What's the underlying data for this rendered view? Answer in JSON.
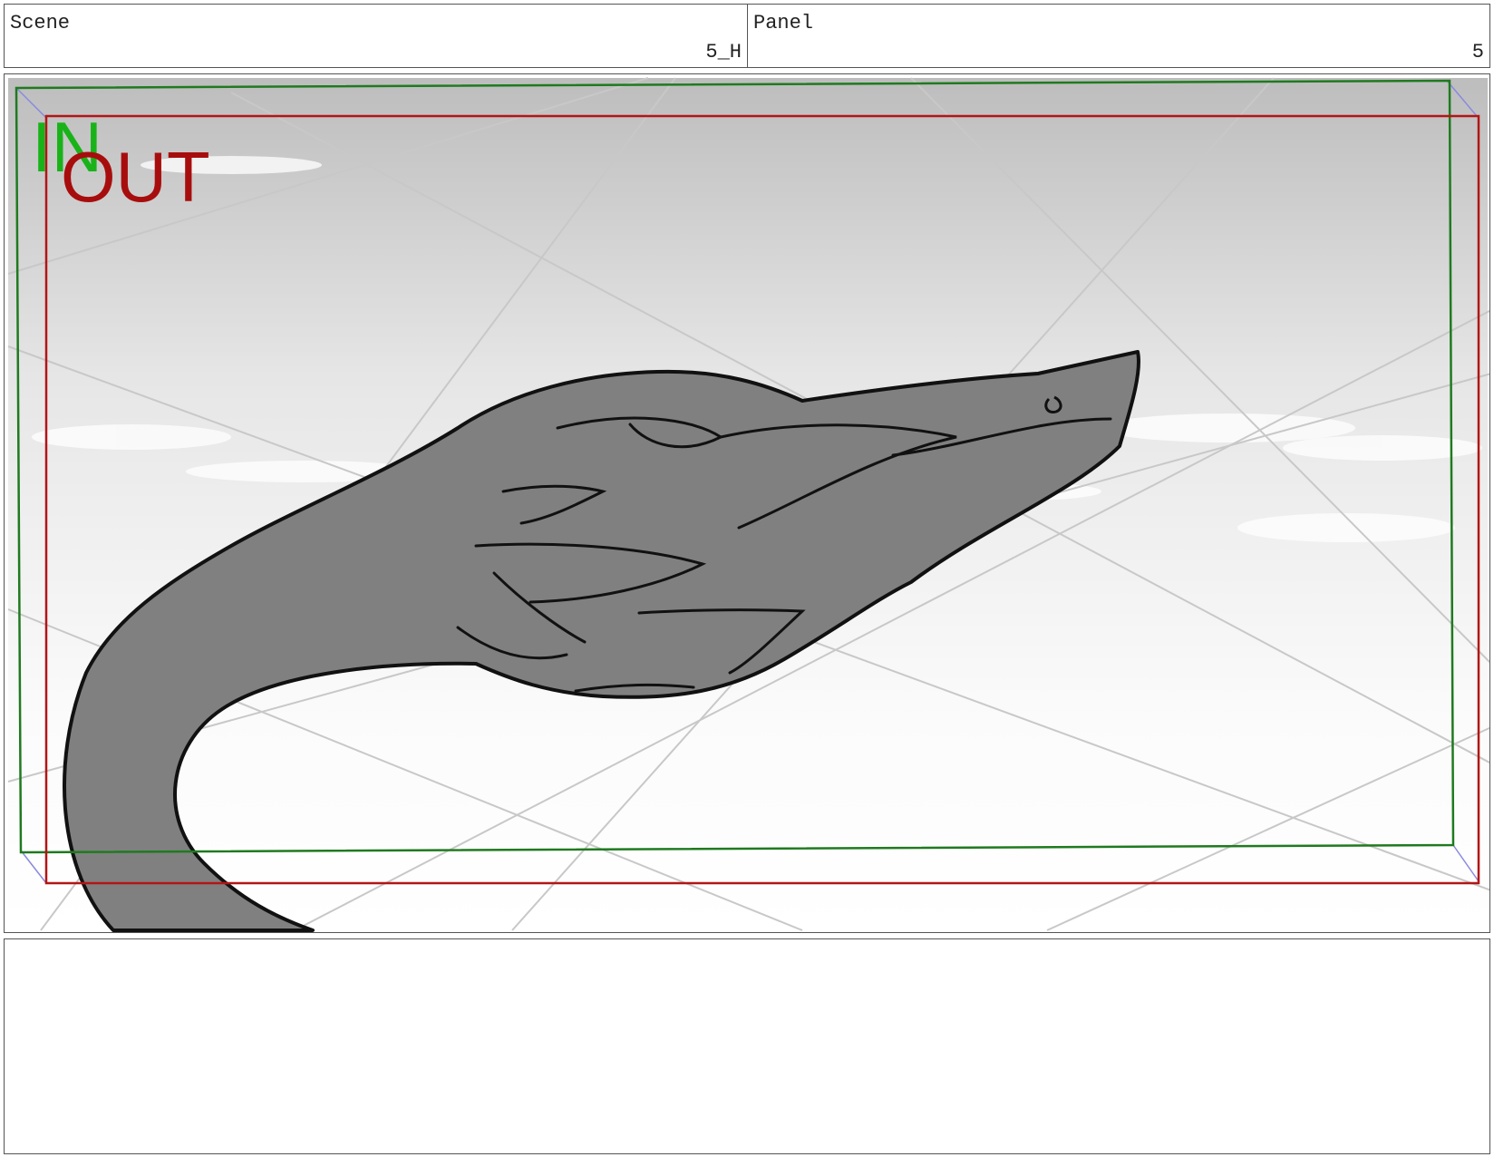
{
  "header": {
    "scene": {
      "label": "Scene",
      "value": "5_H"
    },
    "panel": {
      "label": "Panel",
      "value": "5"
    }
  },
  "panel_image": {
    "subject": "ink sketch of a large bird's head and neck against a cloudy grey sky",
    "in_frame_label": "IN",
    "out_frame_label": "OUT",
    "colors": {
      "in_frame": "#1f7a1f",
      "in_label": "#19b319",
      "out_frame": "#b31515",
      "out_label": "#a80d0d",
      "guide_lines": "#c8c8c8",
      "corner_arrows": "#8a8ae0",
      "fill": "#808080"
    }
  },
  "notes": {
    "text": ""
  }
}
